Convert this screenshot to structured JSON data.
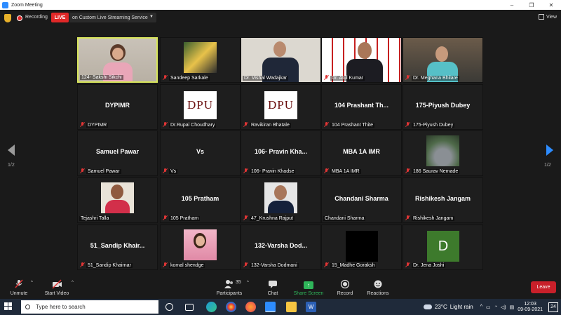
{
  "window": {
    "title": "Zoom Meeting",
    "controls": [
      "–",
      "❐",
      "✕"
    ]
  },
  "topbar": {
    "recording_label": "Recording",
    "live_badge": "LIVE",
    "live_service": "on Custom Live Streaming Service",
    "view_label": "View"
  },
  "tiles": [
    {
      "name": "124- Sakshi Sikchi",
      "center": "",
      "muted": false,
      "active": true
    },
    {
      "name": "Sandeep Sarkale",
      "center": "",
      "muted": true
    },
    {
      "name": "Dr. Vishal Wadajkar",
      "center": "",
      "muted": false
    },
    {
      "name": "Dr. Atul Kumar",
      "center": "",
      "muted": true
    },
    {
      "name": "Dr. Meghana Bhilare",
      "center": "",
      "muted": true
    },
    {
      "name": "DYPIMR",
      "center": "DYPIMR",
      "muted": true
    },
    {
      "name": "Dr.Rupal Choudhary",
      "center": "DPU",
      "muted": true
    },
    {
      "name": "Ravikiran Bhatale",
      "center": "DPU",
      "muted": true
    },
    {
      "name": "104 Prashant Thite",
      "center": "104 Prashant Th...",
      "muted": true
    },
    {
      "name": "175-Piyush Dubey",
      "center": "175-Piyush Dubey",
      "muted": true
    },
    {
      "name": "Samuel Pawar",
      "center": "Samuel Pawar",
      "muted": true
    },
    {
      "name": "Vs",
      "center": "Vs",
      "muted": true
    },
    {
      "name": "106- Pravin Khadse",
      "center": "106- Pravin Kha...",
      "muted": true
    },
    {
      "name": "MBA 1A IMR",
      "center": "MBA 1A IMR",
      "muted": true
    },
    {
      "name": "186 Saurav Nemade",
      "center": "",
      "muted": true
    },
    {
      "name": "Tejashri Talla",
      "center": "",
      "muted": false
    },
    {
      "name": "105 Pratham",
      "center": "105 Pratham",
      "muted": true
    },
    {
      "name": "47_Krushna Rajput",
      "center": "",
      "muted": true
    },
    {
      "name": "Chandani Sharma",
      "center": "Chandani Sharma",
      "muted": false
    },
    {
      "name": "Rishikesh Jangam",
      "center": "Rishikesh Jangam",
      "muted": true
    },
    {
      "name": "51_Sandip Khairnar",
      "center": "51_Sandip Khair...",
      "muted": true
    },
    {
      "name": "komal shendge",
      "center": "",
      "muted": true
    },
    {
      "name": "132-Varsha Dodmani",
      "center": "132-Varsha Dod...",
      "muted": true
    },
    {
      "name": "15_Madhe Goraksh",
      "center": "",
      "muted": true
    },
    {
      "name": "Dr. Jena Joshi",
      "center": "D",
      "muted": true
    }
  ],
  "pagination": {
    "left": "1/2",
    "right": "1/2"
  },
  "toolbar": {
    "unmute": "Unmute",
    "start_video": "Start Video",
    "participants": "Participants",
    "participants_count": "35",
    "chat": "Chat",
    "share_screen": "Share Screen",
    "record": "Record",
    "reactions": "Reactions",
    "leave": "Leave"
  },
  "taskbar": {
    "search_placeholder": "Type here to search",
    "temperature": "23°C",
    "weather": "Light rain",
    "time": "12:03",
    "date": "09-09-2021",
    "notifications": "24"
  }
}
